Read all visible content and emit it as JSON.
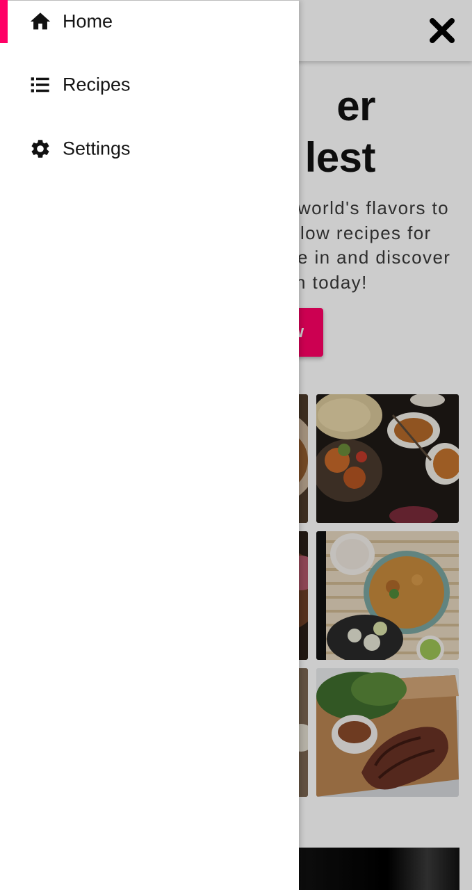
{
  "drawer": {
    "items": [
      {
        "label": "Home",
        "icon": "home-icon",
        "active": true
      },
      {
        "label": "Recipes",
        "icon": "list-icon",
        "active": false
      },
      {
        "label": "Settings",
        "icon": "gear-icon",
        "active": false
      }
    ]
  },
  "appbar": {
    "close_icon": "close-icon"
  },
  "hero": {
    "title_line1": "er",
    "title_line2": "lest",
    "text": "world's flavors to low recipes for e in and discover h today!",
    "button_label": "w"
  },
  "colors": {
    "accent": "#ff0066",
    "drawer_background": "#ffffff",
    "text_dark": "#151515",
    "scrim": "rgba(0,0,0,0.2)"
  }
}
